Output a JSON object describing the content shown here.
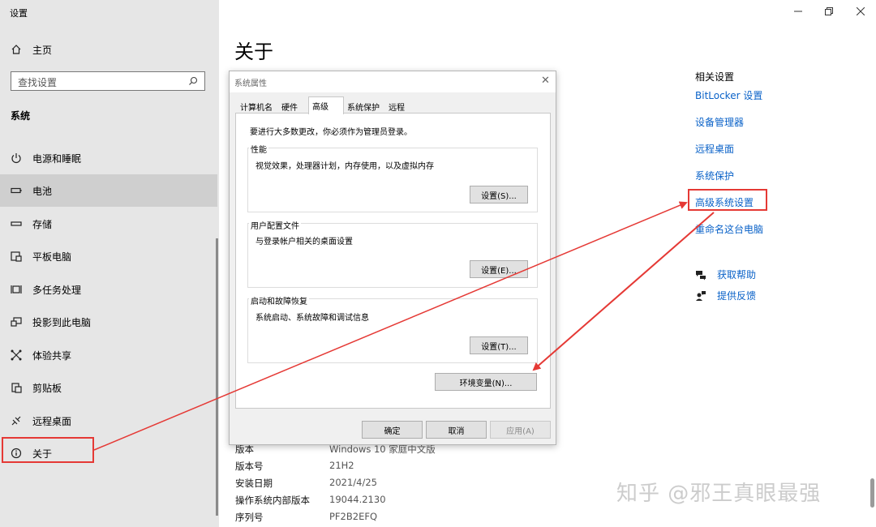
{
  "app": {
    "title": "设置"
  },
  "sidebar": {
    "home": "主页",
    "search_placeholder": "查找设置",
    "category": "系统",
    "items": [
      {
        "label": "电源和睡眠",
        "icon": "power-icon"
      },
      {
        "label": "电池",
        "icon": "battery-icon"
      },
      {
        "label": "存储",
        "icon": "storage-icon"
      },
      {
        "label": "平板电脑",
        "icon": "tablet-icon"
      },
      {
        "label": "多任务处理",
        "icon": "multitasking-icon"
      },
      {
        "label": "投影到此电脑",
        "icon": "project-icon"
      },
      {
        "label": "体验共享",
        "icon": "shared-experiences-icon"
      },
      {
        "label": "剪贴板",
        "icon": "clipboard-icon"
      },
      {
        "label": "远程桌面",
        "icon": "remote-desktop-icon"
      },
      {
        "label": "关于",
        "icon": "info-icon"
      }
    ]
  },
  "main": {
    "title": "关于",
    "specs": [
      {
        "label": "版本",
        "value": "Windows 10 家庭中文版"
      },
      {
        "label": "版本号",
        "value": "21H2"
      },
      {
        "label": "安装日期",
        "value": "2021/4/25"
      },
      {
        "label": "操作系统内部版本",
        "value": "19044.2130"
      },
      {
        "label": "序列号",
        "value": "PF2B2EFQ"
      }
    ]
  },
  "related": {
    "title": "相关设置",
    "links": [
      "BitLocker 设置",
      "设备管理器",
      "远程桌面",
      "系统保护",
      "高级系统设置",
      "重命名这台电脑"
    ],
    "help": "获取帮助",
    "feedback": "提供反馈"
  },
  "dialog": {
    "title": "系统属性",
    "tabs": [
      "计算机名",
      "硬件",
      "高级",
      "系统保护",
      "远程"
    ],
    "admin_note": "要进行大多数更改，你必须作为管理员登录。",
    "perf_title": "性能",
    "perf_desc": "视觉效果，处理器计划，内存使用，以及虚拟内存",
    "perf_btn": "设置(S)...",
    "profile_title": "用户配置文件",
    "profile_desc": "与登录帐户相关的桌面设置",
    "profile_btn": "设置(E)...",
    "startup_title": "启动和故障恢复",
    "startup_desc": "系统启动、系统故障和调试信息",
    "startup_btn": "设置(T)...",
    "env_btn": "环境变量(N)...",
    "ok": "确定",
    "cancel": "取消",
    "apply": "应用(A)"
  },
  "watermark": "知乎 @邪王真眼最强",
  "colors": {
    "link": "#0a62c8",
    "highlight": "#e53935",
    "sidebar_bg": "#e6e6e6"
  }
}
